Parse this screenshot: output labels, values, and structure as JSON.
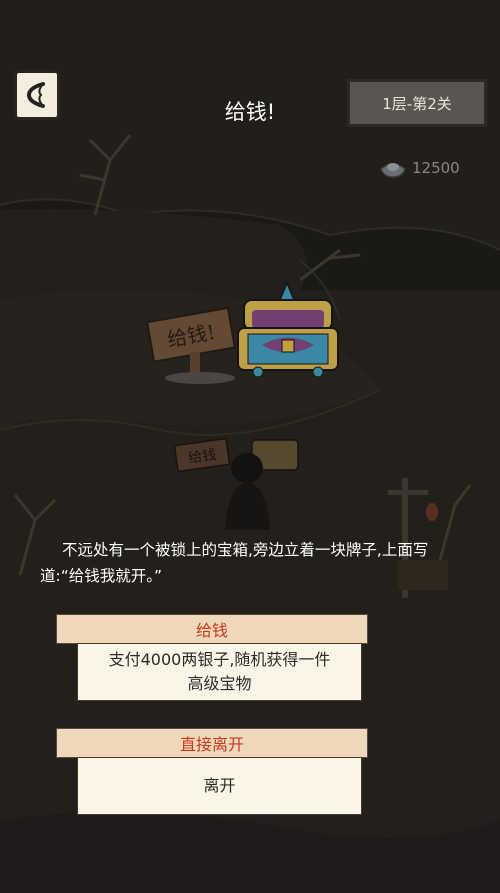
{
  "header": {
    "back_icon": "back-arrow-icon",
    "title": "给钱!",
    "level_label": "1层-第2关"
  },
  "currency": {
    "icon": "silver-ingot-icon",
    "value": "12500"
  },
  "scene": {
    "sign_text": "给钱!",
    "small_sign_text": "给钱"
  },
  "event": {
    "description": "不远处有一个被锁上的宝箱,旁边立着一块牌子,上面写道:“给钱我就开。”"
  },
  "choices": [
    {
      "title": "给钱",
      "description": "支付4000两银子,随机获得一件高级宝物"
    },
    {
      "title": "直接离开",
      "description": "离开"
    }
  ],
  "colors": {
    "background": "#1e1b17",
    "choice_title": "#c63a1f",
    "choice_tab_bg": "#efd7ba",
    "choice_card_bg": "#fbf5e7",
    "chest_gold": "#e9c45a",
    "chest_blue": "#4aa6c8"
  }
}
